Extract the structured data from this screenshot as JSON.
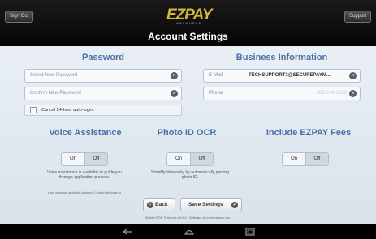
{
  "header": {
    "sign_out": "Sign Out",
    "support": "Support",
    "logo_mark": "EZPAY",
    "logo_sub": "ANYWHERE",
    "title": "Account Settings"
  },
  "password": {
    "title": "Password",
    "new_placeholder": "Select New Password",
    "confirm_placeholder": "Confirm New Password",
    "cancel_autologin": "Cancel 24-hour auto-login."
  },
  "business": {
    "title": "Business Information",
    "email_label": "E-Mail",
    "email_value": "TECHSUPPORT3@SECUREPAYM...",
    "phone_label": "Phone",
    "phone_value": "888-549-1323"
  },
  "voice": {
    "title": "Voice Assistance",
    "on": "On",
    "off": "Off",
    "desc": "Voice assistance is available to guide you through application process.",
    "help": "Have questions about this software? Contact developer at"
  },
  "photo": {
    "title": "Photo ID OCR",
    "on": "On",
    "off": "Off",
    "desc": "Simplify data entry by automatically parsing photo ID."
  },
  "fees": {
    "title": "Include EZPAY Fees",
    "on": "On",
    "off": "Off"
  },
  "actions": {
    "back": "Back",
    "save": "Save Settings"
  },
  "footer": "Mobile POS Terminal v 5.0.0 | Software by Intermotech Inc.",
  "icons": {
    "clear": "clear-icon",
    "back": "back-arrow-icon",
    "save": "check-icon"
  }
}
